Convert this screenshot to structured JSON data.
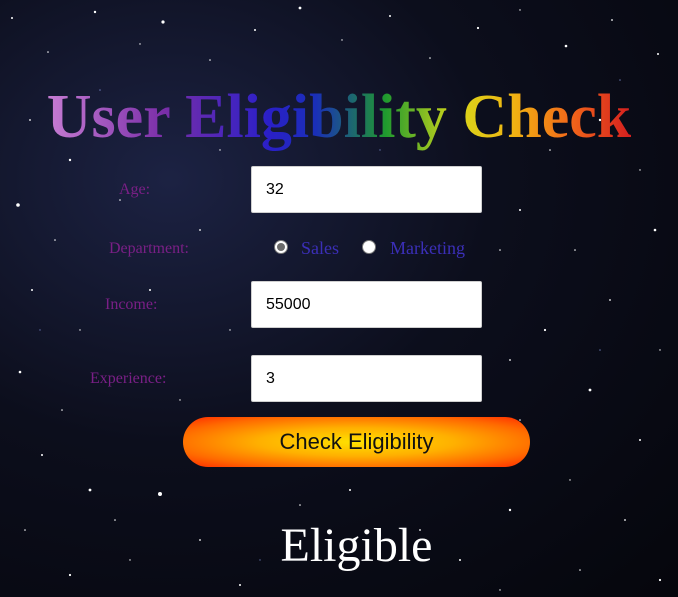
{
  "title": "User Eligibility Check",
  "form": {
    "age": {
      "label": "Age:",
      "value": "32"
    },
    "department": {
      "label": "Department:",
      "options": [
        "Sales",
        "Marketing"
      ],
      "selected": "Sales"
    },
    "income": {
      "label": "Income:",
      "value": "55000"
    },
    "experience": {
      "label": "Experience:",
      "value": "3"
    }
  },
  "button_label": "Check Eligibility",
  "result": "Eligible",
  "colors": {
    "label": "#7a1f86",
    "radio_label": "#3b2fb8",
    "result": "#ffffff",
    "button_center": "#ffe100",
    "button_edge": "#ff2a00"
  }
}
